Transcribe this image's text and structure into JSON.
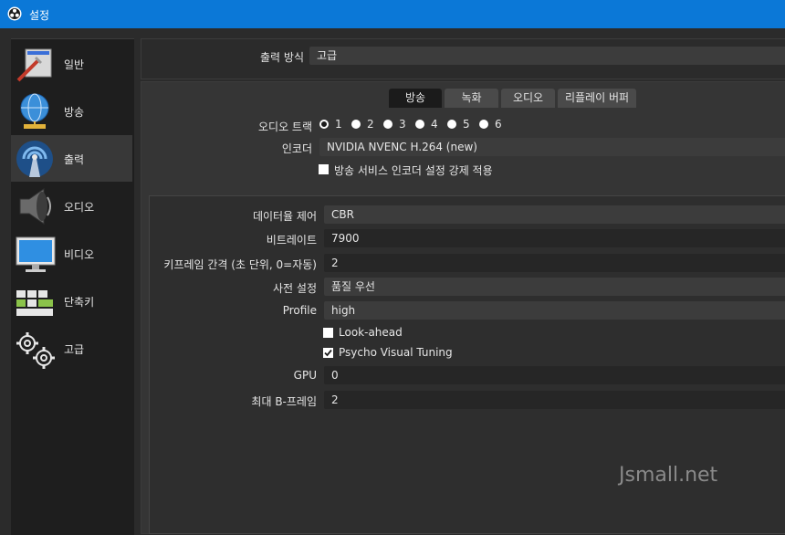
{
  "window": {
    "title": "설정"
  },
  "sidebar": {
    "items": [
      {
        "label": "일반",
        "icon": "general-settings-icon"
      },
      {
        "label": "방송",
        "icon": "globe-stream-icon"
      },
      {
        "label": "출력",
        "icon": "output-antenna-icon"
      },
      {
        "label": "오디오",
        "icon": "speaker-icon"
      },
      {
        "label": "비디오",
        "icon": "monitor-icon"
      },
      {
        "label": "단축키",
        "icon": "keyboard-icon"
      },
      {
        "label": "고급",
        "icon": "gears-icon"
      }
    ],
    "active_index": 2
  },
  "output_mode": {
    "label": "출력 방식",
    "value": "고급"
  },
  "tabs": {
    "labels": [
      "방송",
      "녹화",
      "오디오",
      "리플레이 버퍼"
    ],
    "active_index": 0
  },
  "streaming": {
    "audio_track_label": "오디오 트랙",
    "audio_tracks": [
      "1",
      "2",
      "3",
      "4",
      "5",
      "6"
    ],
    "selected_track": "1",
    "encoder_label": "인코더",
    "encoder_value": "NVIDIA NVENC H.264 (new)",
    "enforce_label": "방송 서비스 인코더 설정 강제 적용",
    "enforce_checked": false
  },
  "encoder_settings": {
    "rate_control_label": "데이터율 제어",
    "rate_control_value": "CBR",
    "bitrate_label": "비트레이트",
    "bitrate_value": "7900",
    "keyframe_label": "키프레임 간격 (초 단위, 0=자동)",
    "keyframe_value": "2",
    "preset_label": "사전 설정",
    "preset_value": "품질 우선",
    "profile_label": "Profile",
    "profile_value": "high",
    "lookahead_label": "Look-ahead",
    "lookahead_checked": false,
    "psycho_label": "Psycho Visual Tuning",
    "psycho_checked": true,
    "gpu_label": "GPU",
    "gpu_value": "0",
    "bframes_label": "최대 B-프레임",
    "bframes_value": "2"
  },
  "watermark": "Jsmall.net",
  "colors": {
    "titlebar": "#0b78d7",
    "background": "#2b2b2b",
    "sidebar": "#1e1e1e"
  }
}
